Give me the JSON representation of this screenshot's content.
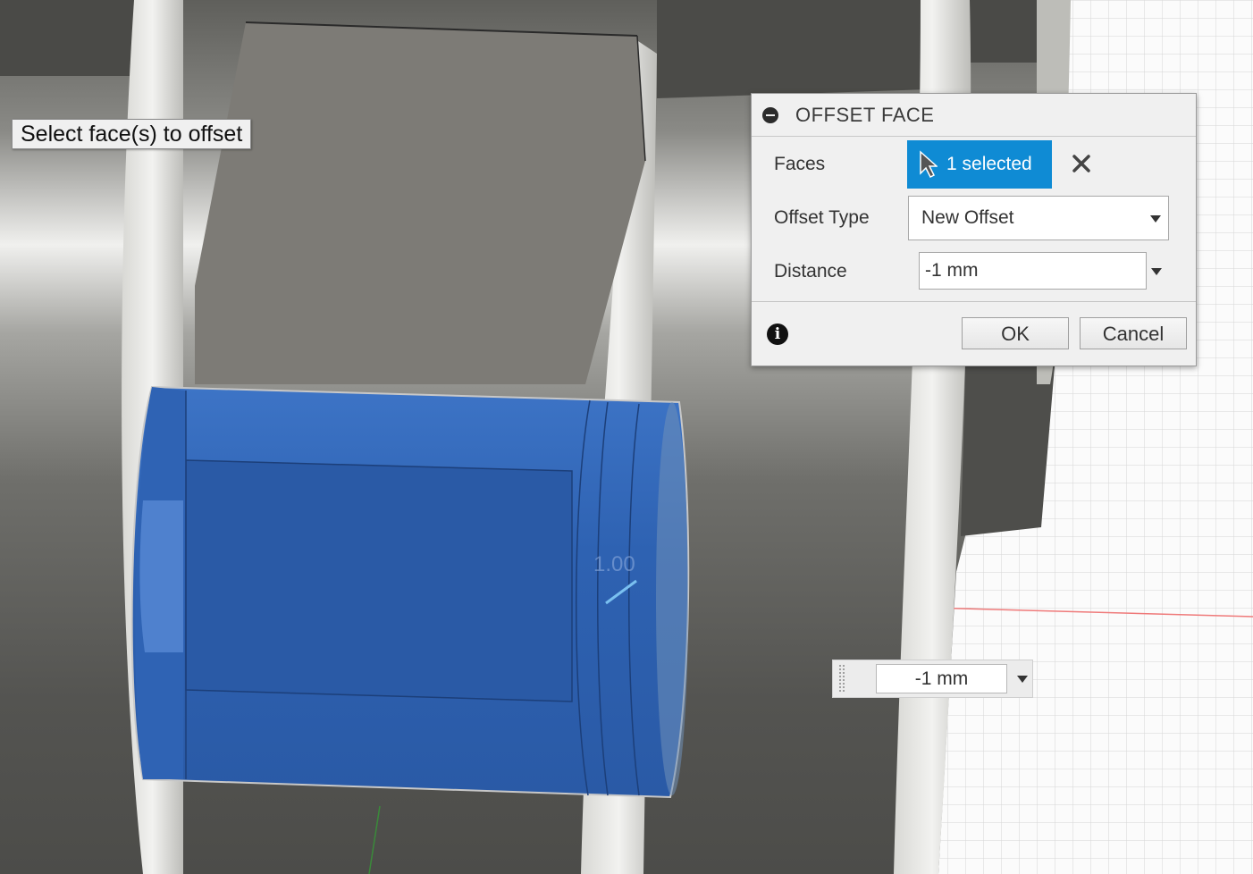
{
  "prompt": {
    "text": "Select face(s) to offset"
  },
  "dialog": {
    "title": "OFFSET FACE",
    "faces": {
      "label": "Faces",
      "value": "1 selected"
    },
    "offset_type": {
      "label": "Offset Type",
      "value": "New Offset"
    },
    "distance": {
      "label": "Distance",
      "value": "-1 mm"
    },
    "ok_label": "OK",
    "cancel_label": "Cancel"
  },
  "inline_input": {
    "value": "-1 mm"
  },
  "dimension_label": "1.00",
  "colors": {
    "selection_blue": "#2c63b8",
    "accent": "#0f8bd4"
  },
  "icons": [
    "collapse-icon",
    "cursor-icon",
    "clear-x-icon",
    "dropdown-caret-icon",
    "info-icon",
    "grip-icon"
  ]
}
